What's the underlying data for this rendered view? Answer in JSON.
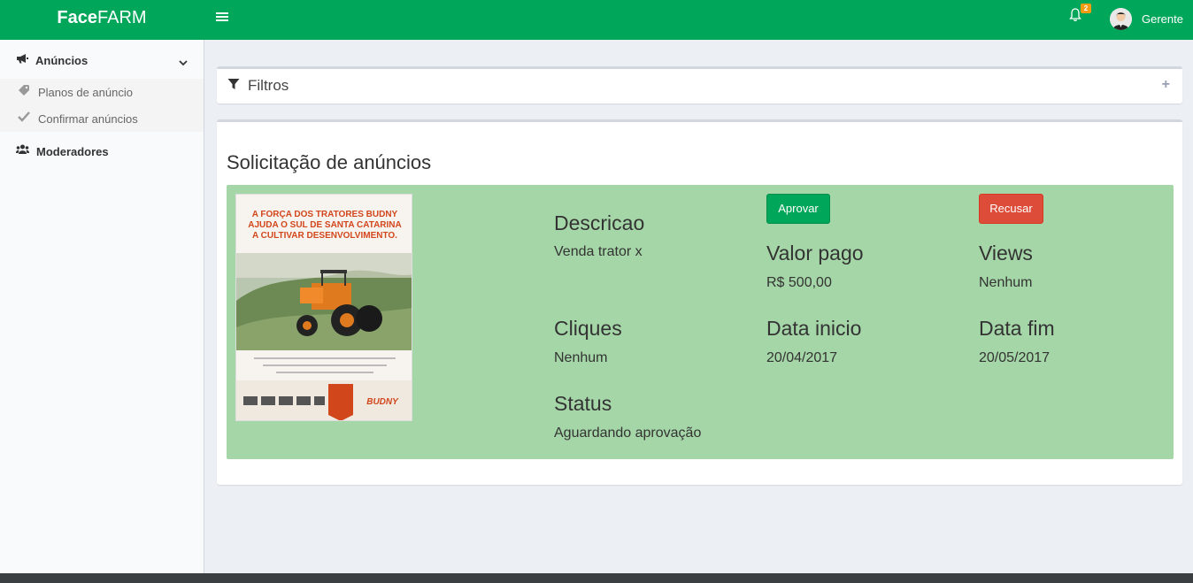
{
  "header": {
    "logo_bold": "Face",
    "logo_rest": "FARM",
    "notifications_count": "2",
    "user_name": "Gerente",
    "color": "#00a65a"
  },
  "sidebar": {
    "section": {
      "label": "Anúncios",
      "icon": "bullhorn-icon",
      "items": [
        {
          "label": "Planos de anúncio",
          "icon": "tag-icon"
        },
        {
          "label": "Confirmar anúncios",
          "icon": "check-icon"
        }
      ]
    },
    "moderators": {
      "label": "Moderadores",
      "icon": "users-icon"
    }
  },
  "filters": {
    "title": "Filtros",
    "toggle": "+"
  },
  "main": {
    "title": "Solicitação de anúncios",
    "ad": {
      "image_text": {
        "headline": "A FORÇA DOS TRATORES BUDNY AJUDA O SUL DE SANTA CATARINA A CULTIVAR DESENVOLVIMENTO.",
        "brand": "BUDNY"
      },
      "approve_label": "Aprovar",
      "refuse_label": "Recusar",
      "fields": {
        "descricao_label": "Descricao",
        "descricao_value": "Venda trator x",
        "valor_label": "Valor pago",
        "valor_value": "R$ 500,00",
        "views_label": "Views",
        "views_value": "Nenhum",
        "cliques_label": "Cliques",
        "cliques_value": "Nenhum",
        "data_inicio_label": "Data inicio",
        "data_inicio_value": "20/04/2017",
        "data_fim_label": "Data fim",
        "data_fim_value": "20/05/2017",
        "status_label": "Status",
        "status_value": "Aguardando aprovação"
      },
      "background_color": "#a5d6a7"
    }
  }
}
